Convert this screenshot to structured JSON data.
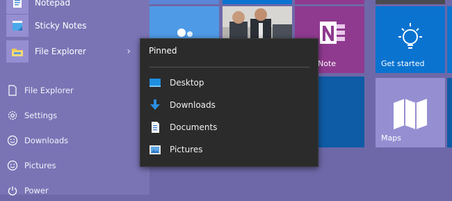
{
  "start_list": {
    "apps": [
      {
        "label": "Notepad",
        "icon": "notepad-icon"
      },
      {
        "label": "Sticky Notes",
        "icon": "sticky-notes-icon"
      },
      {
        "label": "File Explorer",
        "icon": "file-explorer-icon"
      }
    ],
    "system": [
      {
        "label": "File Explorer",
        "icon": "file-icon"
      },
      {
        "label": "Settings",
        "icon": "gear-icon"
      },
      {
        "label": "Downloads",
        "icon": "smiley-icon"
      },
      {
        "label": "Pictures",
        "icon": "smiley-icon"
      },
      {
        "label": "Power",
        "icon": "power-icon"
      }
    ]
  },
  "jumplist": {
    "header": "Pinned",
    "items": [
      {
        "label": "Desktop",
        "icon": "desktop-icon"
      },
      {
        "label": "Downloads",
        "icon": "download-arrow-icon"
      },
      {
        "label": "Documents",
        "icon": "document-icon"
      },
      {
        "label": "Pictures",
        "icon": "picture-icon"
      }
    ]
  },
  "tiles": {
    "onenote_label": "Note",
    "get_started_label": "Get started",
    "maps_label": "Maps"
  },
  "colors": {
    "background": "#6e68a8",
    "accent_blue": "#0a73d0",
    "onenote_purple": "#8f3a8f",
    "tile_lavender": "#958fd2",
    "jumplist_bg": "#2b2b2b"
  }
}
